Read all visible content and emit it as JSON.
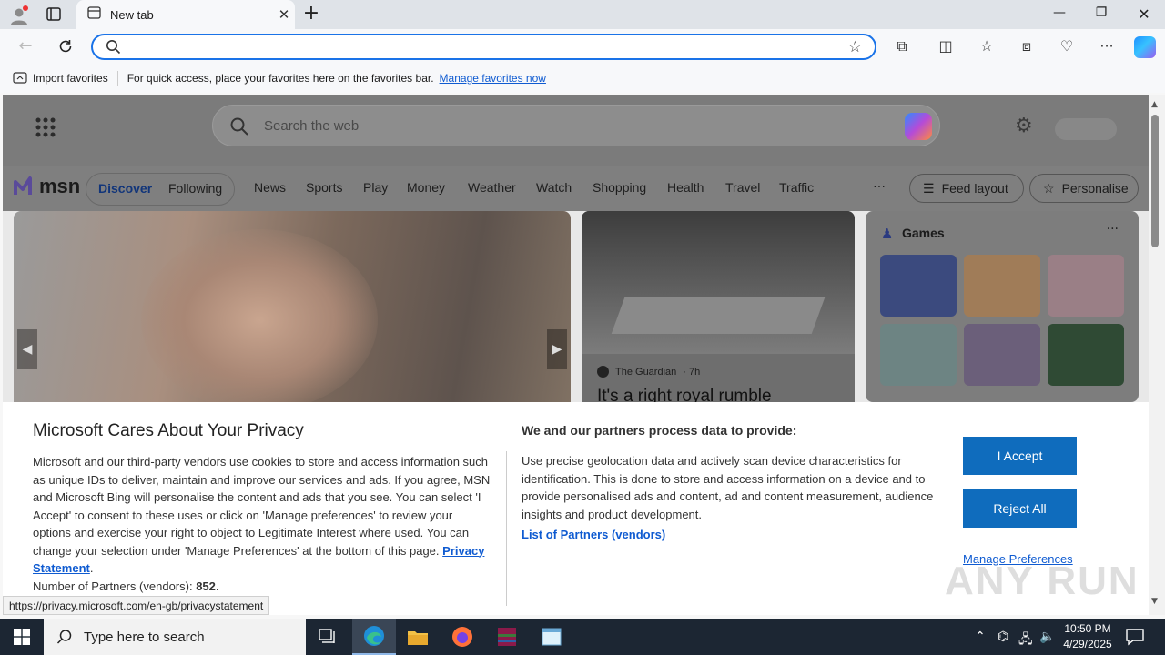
{
  "browser": {
    "tab_title": "New tab",
    "address_placeholder": "",
    "favorites_bar": {
      "import_label": "Import favorites",
      "hint": "For quick access, place your favorites here on the favorites bar.",
      "manage_link": "Manage favorites now"
    },
    "status_url": "https://privacy.microsoft.com/en-gb/privacystatement"
  },
  "msn": {
    "search_placeholder": "Search the web",
    "logo_text": "msn",
    "pill_tabs": [
      "Discover",
      "Following"
    ],
    "nav_items": [
      "News",
      "Sports",
      "Play",
      "Money",
      "Weather",
      "Watch",
      "Shopping",
      "Health",
      "Travel",
      "Traffic"
    ],
    "more": "···",
    "feed_layout": "Feed layout",
    "personalise": "Personalise",
    "story": {
      "source": "The Guardian",
      "age": "· 7h",
      "headline": "It's a right royal rumble"
    },
    "games_title": "Games"
  },
  "privacy": {
    "title": "Microsoft Cares About Your Privacy",
    "body": "Microsoft and our third-party vendors use cookies to store and access information such as unique IDs to deliver, maintain and improve our services and ads. If you agree, MSN and Microsoft Bing will personalise the content and ads that you see. You can select 'I Accept' to consent to these uses or click on 'Manage preferences' to review your options and exercise your right to object to Legitimate Interest where used.  You can change your selection under 'Manage Preferences' at the bottom of this page.",
    "privacy_link": "Privacy Statement",
    "partners_label": "Number of Partners (vendors):",
    "partners_count": "852",
    "right_title": "We and our partners process data to provide:",
    "right_body": "Use precise geolocation data and actively scan device characteristics for identification. This is done to store and access information on a device and to provide personalised ads and content, ad and content measurement, audience insights and product development.",
    "partners_link": "List of Partners (vendors)",
    "accept": "I Accept",
    "reject": "Reject All",
    "manage": "Manage Preferences"
  },
  "taskbar": {
    "search_placeholder": "Type here to search",
    "time": "10:50 PM",
    "date": "4/29/2025"
  },
  "watermark": "ANY RUN",
  "colors": {
    "accent": "#0f6cbd",
    "link": "#0f5bd1",
    "taskbar": "#1c2633"
  }
}
